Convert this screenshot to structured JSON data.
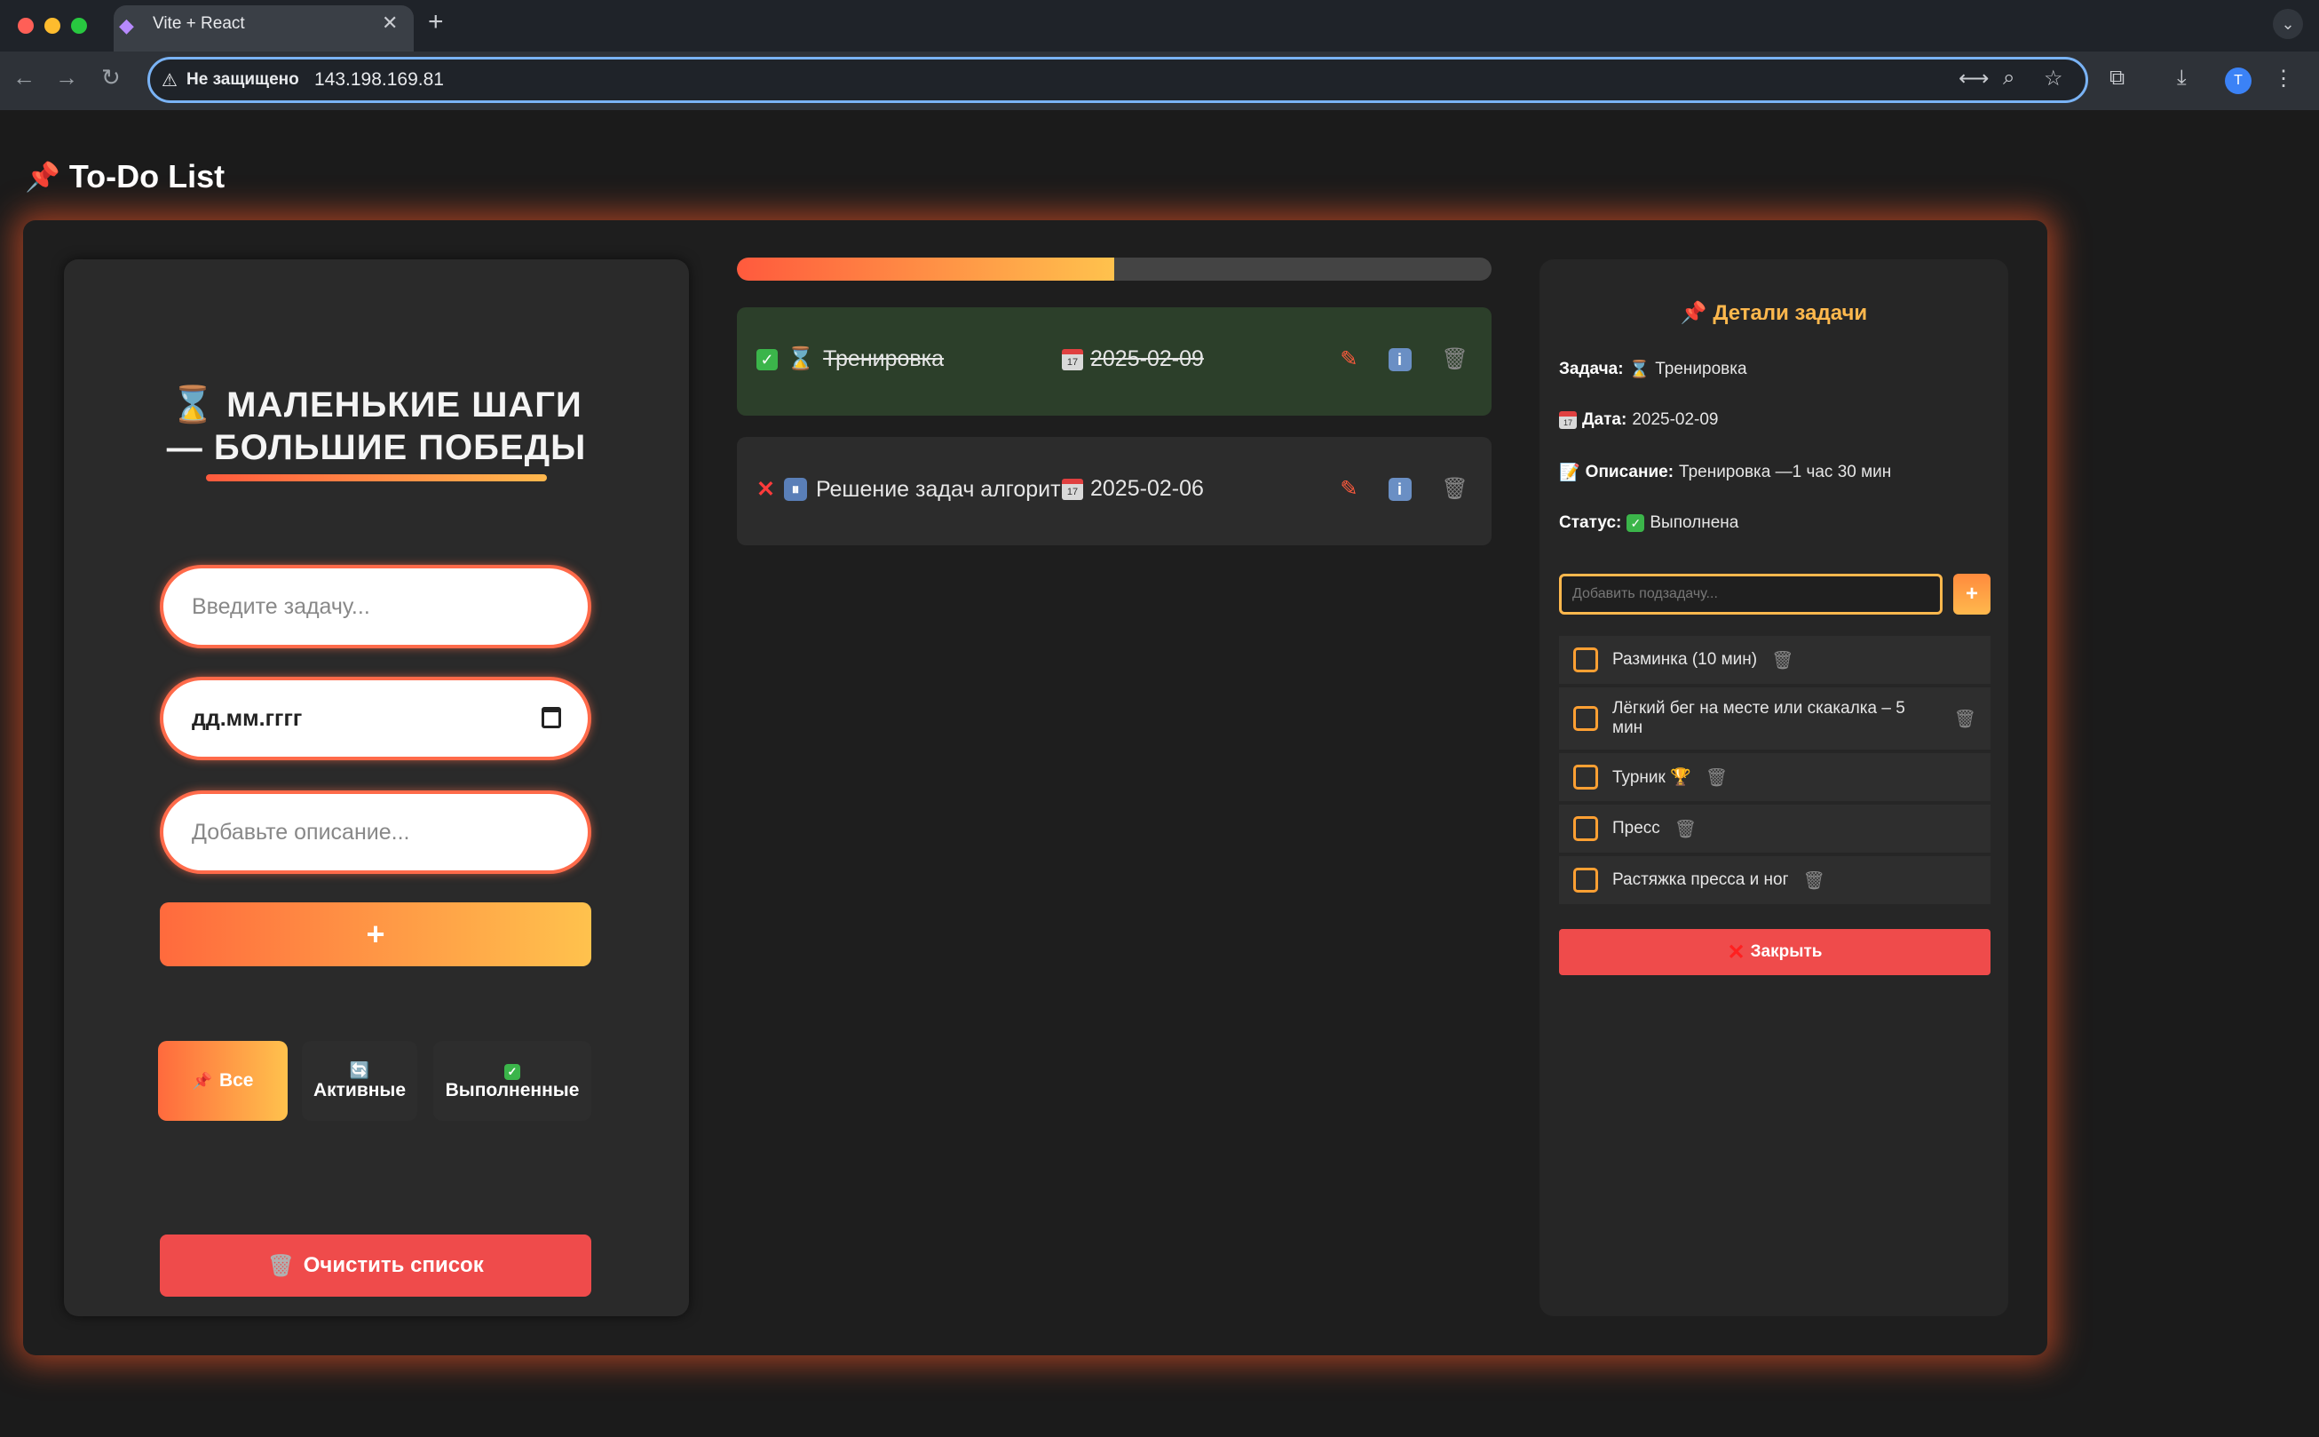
{
  "browser": {
    "tab_title": "Vite + React",
    "tab_close": "✕",
    "tab_new": "+",
    "security_label": "Не защищено",
    "url": "143.198.169.81",
    "profile_initial": "T"
  },
  "page": {
    "title": "To-Do List"
  },
  "left": {
    "motto_line1": "⌛ МАЛЕНЬКИЕ ШАГИ",
    "motto_line2": "— БОЛЬШИЕ ПОБЕДЫ",
    "task_placeholder": "Введите задачу...",
    "date_placeholder": "дд.мм.гггг",
    "description_placeholder": "Добавьте описание...",
    "add_label": "+",
    "filters": {
      "all": "Все",
      "active": "Активные",
      "done": "Выполненные"
    },
    "clear_label": "Очистить список"
  },
  "progress": {
    "fraction": 0.5
  },
  "tasks": [
    {
      "title": "Тренировка",
      "date": "2025-02-09",
      "status": "done"
    },
    {
      "title": "Решение задач алгоритм",
      "date": "2025-02-06",
      "status": "pending"
    }
  ],
  "details": {
    "title": "Детали задачи",
    "task_label": "Задача:",
    "task_value": "Тренировка",
    "date_label": "Дата:",
    "date_value": "2025-02-09",
    "description_label": "Описание:",
    "description_value": "Тренировка —1 час 30 мин",
    "status_label": "Статус:",
    "status_value": "Выполнена",
    "subtask_placeholder": "Добавить подзадачу...",
    "subtask_add": "+",
    "subtasks": [
      "Разминка (10 мин)",
      "Лёгкий бег на месте или скакалка – 5 мин",
      "Турник 🏆",
      "Пресс",
      "Растяжка пресса и ног"
    ],
    "close_label": "Закрыть"
  },
  "colors": {
    "accent_orange": "#ff6a3d",
    "accent_yellow": "#ffc24d",
    "danger": "#ef4b4b",
    "done_bg": "#2c3f2a"
  }
}
